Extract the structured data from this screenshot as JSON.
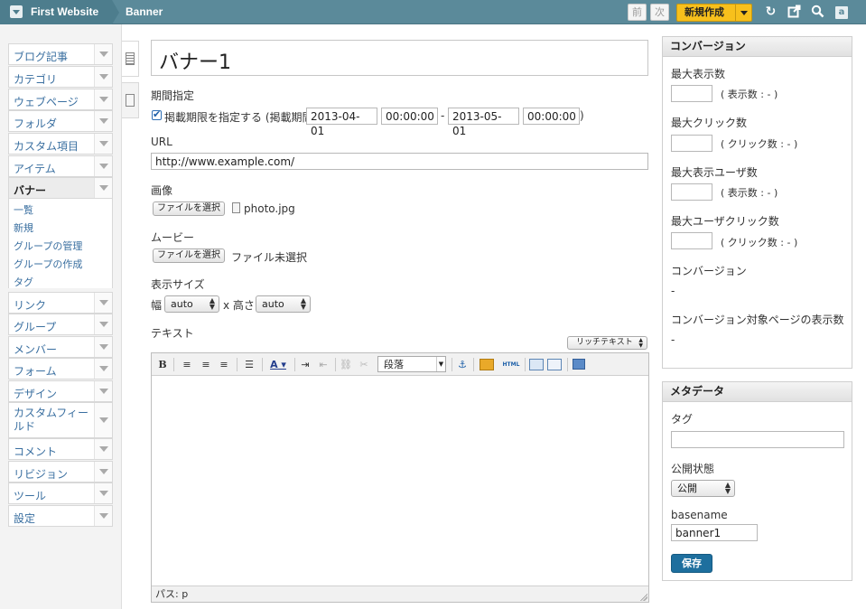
{
  "topbar": {
    "site_name": "First Website",
    "breadcrumb": "Banner",
    "prev_label": "前",
    "next_label": "次",
    "new_label": "新規作成",
    "user_icon_label": "a"
  },
  "sidebar": {
    "items": [
      {
        "label": "ブログ記事"
      },
      {
        "label": "カテゴリ"
      },
      {
        "label": "ウェブページ"
      },
      {
        "label": "フォルダ"
      },
      {
        "label": "カスタム項目"
      },
      {
        "label": "アイテム"
      },
      {
        "label": "バナー"
      },
      {
        "label": "リンク"
      },
      {
        "label": "グループ"
      },
      {
        "label": "メンバー"
      },
      {
        "label": "フォーム"
      },
      {
        "label": "デザイン"
      },
      {
        "label": "カスタムフィールド"
      },
      {
        "label": "コメント"
      },
      {
        "label": "リビジョン"
      },
      {
        "label": "ツール"
      },
      {
        "label": "設定"
      }
    ],
    "submenu": [
      {
        "label": "一覧"
      },
      {
        "label": "新規"
      },
      {
        "label": "グループの管理"
      },
      {
        "label": "グループの作成"
      },
      {
        "label": "タグ"
      }
    ]
  },
  "form": {
    "title_value": "バナー1",
    "period": {
      "label": "期間指定",
      "checkbox_label": "掲載期限を指定する (掲載期間",
      "start_date": "2013-04-01",
      "start_time": "00:00:00",
      "dash": "-",
      "end_date": "2013-05-01",
      "end_time": "00:00:00",
      "close_paren": ")",
      "checked": true
    },
    "url": {
      "label": "URL",
      "value": "http://www.example.com/"
    },
    "image": {
      "label": "画像",
      "button": "ファイルを選択",
      "file": "photo.jpg"
    },
    "movie": {
      "label": "ムービー",
      "button": "ファイルを選択",
      "file": "ファイル未選択"
    },
    "size": {
      "label": "表示サイズ",
      "width_label": "幅",
      "width_value": "auto",
      "x_label": "x 高さ",
      "height_value": "auto"
    },
    "text": {
      "label": "テキスト",
      "mode": "リッチテキスト",
      "format_value": "段落",
      "path_label": "パス: p"
    }
  },
  "conversion_panel": {
    "title": "コンバージョン",
    "max_impressions_label": "最大表示数",
    "impressions_note": "( 表示数 : - )",
    "max_clicks_label": "最大クリック数",
    "clicks_note": "( クリック数 : - )",
    "max_view_users_label": "最大表示ユーザ数",
    "view_users_note": "( 表示数 : - )",
    "max_click_users_label": "最大ユーザクリック数",
    "click_users_note": "( クリック数 : - )",
    "conversion_label": "コンバージョン",
    "conversion_value": "-",
    "target_views_label": "コンバージョン対象ページの表示数",
    "target_views_value": "-"
  },
  "meta_panel": {
    "title": "メタデータ",
    "tag_label": "タグ",
    "tag_value": "",
    "status_label": "公開状態",
    "status_value": "公開",
    "basename_label": "basename",
    "basename_value": "banner1",
    "save_label": "保存"
  },
  "colors": {
    "topbar": "#5b8a9a",
    "new_button": "#f7c01c",
    "link": "#3a6fa0",
    "save_button": "#1e6f9e"
  }
}
